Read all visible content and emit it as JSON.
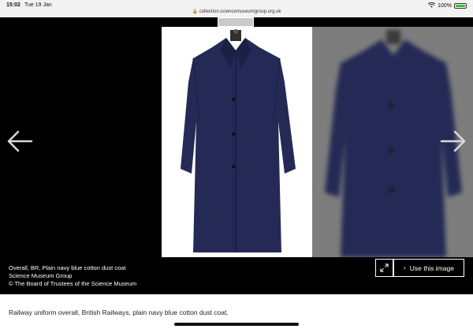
{
  "status_bar": {
    "time": "15:02",
    "date": "Tue 19 Jan",
    "url": "collection.sciencemuseumgroup.org.uk",
    "lock_icon": "lock-icon",
    "wifi_icon": "wifi-icon",
    "battery_text": "100%",
    "battery_level": 1.0,
    "battery_color": "#3ac03a"
  },
  "viewer": {
    "prev_icon": "arrow-left-icon",
    "next_icon": "arrow-right-icon",
    "coat_color": "#242a55",
    "right_panel_color": "#7d7d7d"
  },
  "caption": {
    "title": "Overall, BR, Plain navy blue cotton dust coat",
    "group": "Science Museum Group",
    "copyright": "© The Board of Trustees of the Science Museum"
  },
  "actions": {
    "expand_icon": "expand-icon",
    "use_image_label": "Use this image",
    "use_image_icon": "chevron-right-icon"
  },
  "description": "Railway uniform overall, British Railways, plain navy blue cotton dust coat."
}
